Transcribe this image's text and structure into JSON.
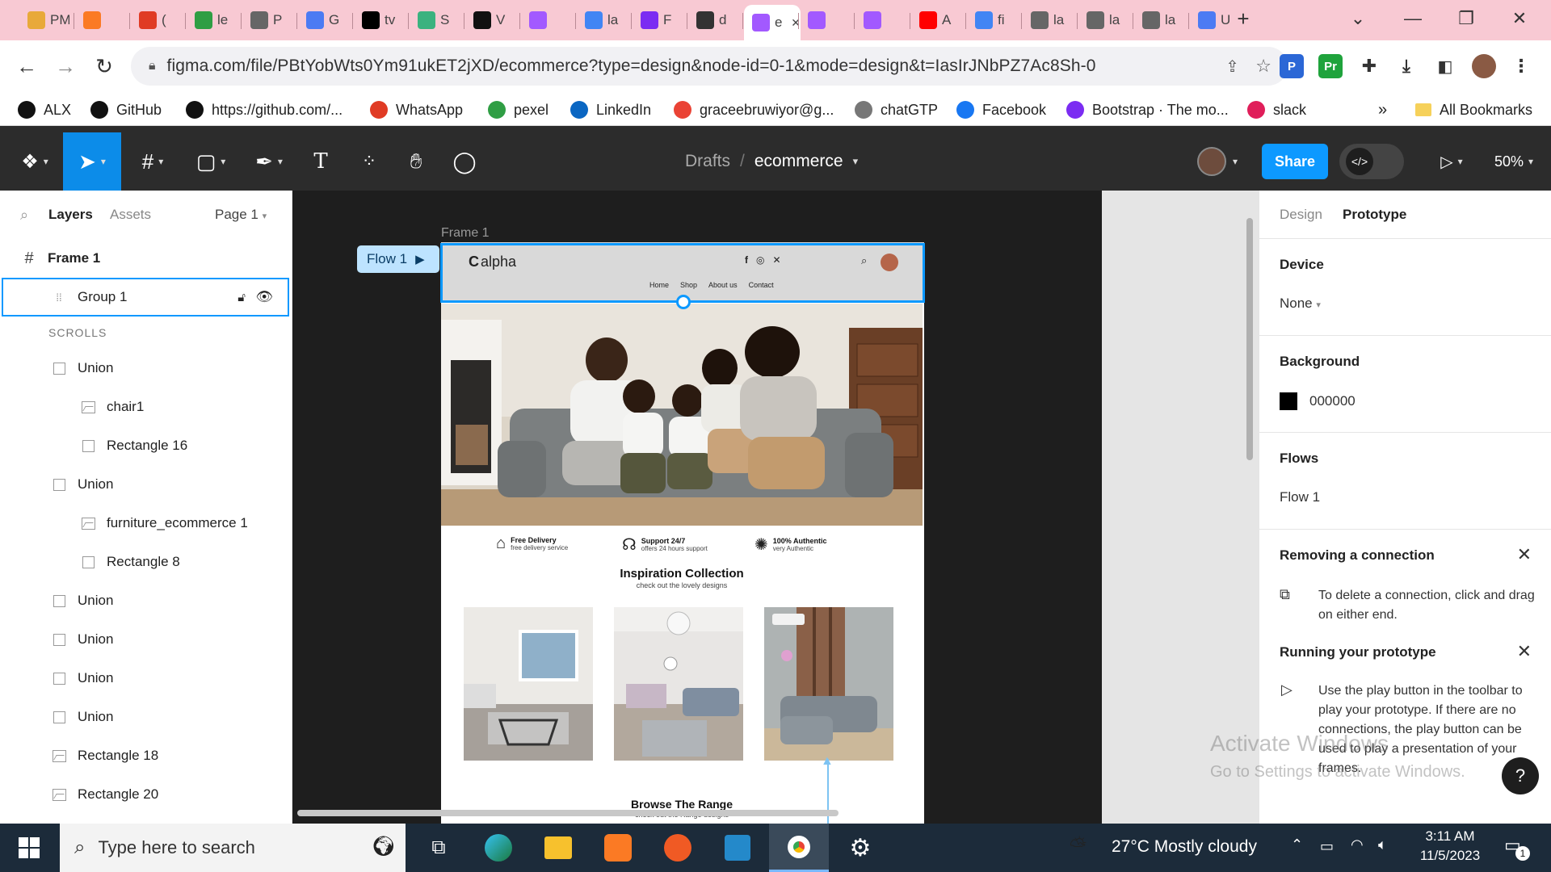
{
  "browser": {
    "tabs": [
      {
        "icon": "pma-icon",
        "title": "PMA",
        "color": "#e8a93a"
      },
      {
        "icon": "xampp-icon",
        "title": "",
        "color": "#fb7a24"
      },
      {
        "icon": "alert-icon",
        "title": "(",
        "color": "#e03b24"
      },
      {
        "icon": "drive-icon",
        "title": "le",
        "color": "#2f9e44"
      },
      {
        "icon": "globe-icon",
        "title": "P",
        "color": "#666666"
      },
      {
        "icon": "docs-icon",
        "title": "G",
        "color": "#4c7bf3"
      },
      {
        "icon": "x-icon",
        "title": "tv",
        "color": "#000000"
      },
      {
        "icon": "vue-icon",
        "title": "S",
        "color": "#3bb27f"
      },
      {
        "icon": "vercel-icon",
        "title": "V",
        "color": "#111111"
      },
      {
        "icon": "figma-icon",
        "title": "",
        "color": "#a259ff"
      },
      {
        "icon": "google-icon",
        "title": "la",
        "color": "#4285f4"
      },
      {
        "icon": "bootstrap-icon",
        "title": "F",
        "color": "#7b2cf2"
      },
      {
        "icon": "github-icon",
        "title": "d",
        "color": "#333333"
      },
      {
        "icon": "figma-icon",
        "title": "e",
        "color": "#a259ff"
      },
      {
        "icon": "figma-icon",
        "title": "",
        "color": "#a259ff"
      },
      {
        "icon": "figma-icon",
        "title": "",
        "color": "#a259ff"
      },
      {
        "icon": "youtube-icon",
        "title": "A",
        "color": "#ff0000"
      },
      {
        "icon": "google-icon",
        "title": "fi",
        "color": "#4285f4"
      },
      {
        "icon": "globe-icon",
        "title": "la",
        "color": "#666666"
      },
      {
        "icon": "globe-icon",
        "title": "la",
        "color": "#666666"
      },
      {
        "icon": "globe-icon",
        "title": "la",
        "color": "#666666"
      },
      {
        "icon": "docs-icon",
        "title": "U",
        "color": "#4c7bf3"
      }
    ],
    "active_tab_index": 13,
    "url": "figma.com/file/PBtYobWts0Ym91ukET2jXD/ecommerce?type=design&node-id=0-1&mode=design&t=IasIrJNbPZ7Ac8Sh-0",
    "bookmarks": [
      {
        "label": "ALX",
        "icon": "alx-icon",
        "color": "#111111"
      },
      {
        "label": "GitHub",
        "icon": "github-icon",
        "color": "#111111"
      },
      {
        "label": "https://github.com/...",
        "icon": "github-icon",
        "color": "#111111"
      },
      {
        "label": "WhatsApp",
        "icon": "alert-icon",
        "color": "#e03b24"
      },
      {
        "label": "pexel",
        "icon": "pexels-icon",
        "color": "#2f9e44"
      },
      {
        "label": "LinkedIn",
        "icon": "linkedin-icon",
        "color": "#0a66c2"
      },
      {
        "label": "graceebruwiyor@g...",
        "icon": "gmail-icon",
        "color": "#ea4335"
      },
      {
        "label": "chatGTP",
        "icon": "openai-icon",
        "color": "#777777"
      },
      {
        "label": "Facebook",
        "icon": "facebook-icon",
        "color": "#1877f2"
      },
      {
        "label": "Bootstrap · The mo...",
        "icon": "bootstrap-icon",
        "color": "#7b2cf2"
      },
      {
        "label": "slack",
        "icon": "slack-icon",
        "color": "#e01e5a"
      }
    ],
    "bookmarks_overflow": "»",
    "all_bookmarks": "All Bookmarks"
  },
  "figma": {
    "breadcrumb_parent": "Drafts",
    "breadcrumb_sep": "/",
    "file_name": "ecommerce",
    "share_label": "Share",
    "zoom": "50%",
    "left_tabs": {
      "layers": "Layers",
      "assets": "Assets",
      "page": "Page 1"
    },
    "frame_title": "Frame 1",
    "layers": [
      {
        "name": "Group 1",
        "type": "group",
        "indent": 1,
        "selected": true
      },
      {
        "name": "SCROLLS",
        "type": "section",
        "indent": 1
      },
      {
        "name": "Union",
        "type": "union",
        "indent": 1
      },
      {
        "name": "chair1",
        "type": "image",
        "indent": 2
      },
      {
        "name": "Rectangle 16",
        "type": "rect",
        "indent": 2
      },
      {
        "name": "Union",
        "type": "union",
        "indent": 1
      },
      {
        "name": "furniture_ecommerce 1",
        "type": "image",
        "indent": 2
      },
      {
        "name": "Rectangle 8",
        "type": "rect",
        "indent": 2
      },
      {
        "name": "Union",
        "type": "union",
        "indent": 1
      },
      {
        "name": "Union",
        "type": "union",
        "indent": 1
      },
      {
        "name": "Union",
        "type": "union",
        "indent": 1
      },
      {
        "name": "Union",
        "type": "union",
        "indent": 1
      },
      {
        "name": "Rectangle 18",
        "type": "image",
        "indent": 1
      },
      {
        "name": "Rectangle 20",
        "type": "image",
        "indent": 1
      }
    ],
    "canvas": {
      "frame_label": "Frame 1",
      "flow_label": "Flow 1",
      "design": {
        "logo": "alpha",
        "nav": [
          "Home",
          "Shop",
          "About us",
          "Contact"
        ],
        "features": [
          {
            "title": "Free Delivery",
            "sub": "free delivery service",
            "icon": "house-icon"
          },
          {
            "title": "Support 24/7",
            "sub": "offers 24 hours support",
            "icon": "headset-icon"
          },
          {
            "title": "100% Authentic",
            "sub": "very Authentic",
            "icon": "badge-icon"
          }
        ],
        "inspiration_title": "Inspiration Collection",
        "inspiration_sub": "check out the lovely designs",
        "browse_title": "Browse The Range",
        "browse_sub": "check out the Range designs"
      }
    },
    "right_tabs": {
      "design": "Design",
      "prototype": "Prototype"
    },
    "device_label": "Device",
    "device_value": "None",
    "background_label": "Background",
    "background_value": "000000",
    "background_color": "#000000",
    "flows_label": "Flows",
    "flow_item": "Flow 1",
    "tip1_title": "Removing a connection",
    "tip1_body": "To delete a connection, click and drag on either end.",
    "tip2_title": "Running your prototype",
    "tip2_body": "Use the play button in the toolbar to play your prototype. If there are no connections, the play button can be used to play a presentation of your frames.",
    "help_label": "?"
  },
  "watermark": {
    "line1": "Activate Windows",
    "line2": "Go to Settings to activate Windows."
  },
  "taskbar": {
    "search_placeholder": "Type here to search",
    "weather": "27°C  Mostly cloudy",
    "time": "3:11 AM",
    "date": "11/5/2023",
    "notifications": "1"
  },
  "colors": {
    "accent": "#0d99ff",
    "tabstrip": "#f8c9d3",
    "taskbar": "#1c2b3a"
  }
}
